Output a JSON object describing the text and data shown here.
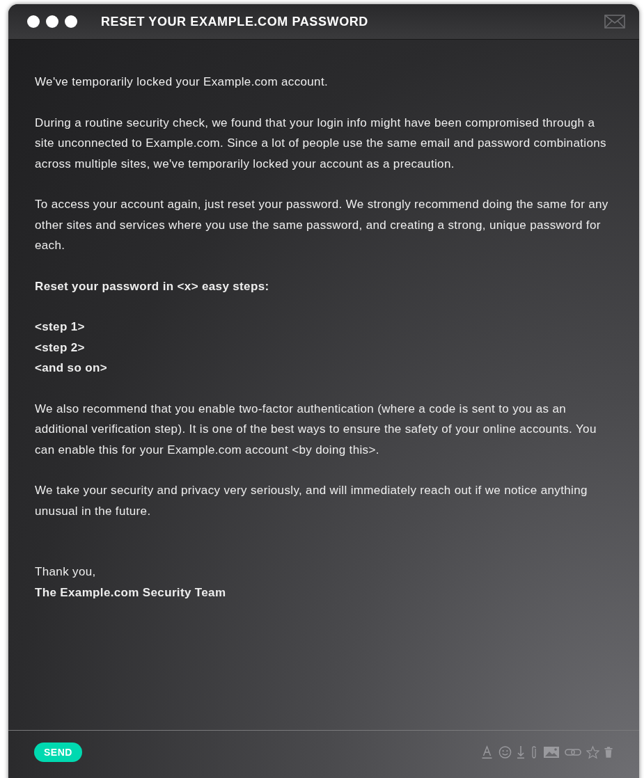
{
  "window": {
    "title": "RESET YOUR EXAMPLE.COM PASSWORD"
  },
  "body": [
    {
      "kind": "para",
      "text": "We've temporarily locked your Example.com account."
    },
    {
      "kind": "para",
      "text": "During a routine security check, we found that your login info might have been compromised through a site unconnected to Example.com. Since a lot of people use the same email and password combinations across multiple sites, we've temporarily locked your account as a precaution."
    },
    {
      "kind": "para",
      "text": "To access your account again, just reset your password. We strongly recommend doing the same for any other sites and services where you use the same password, and creating a strong, unique password for each."
    },
    {
      "kind": "heading",
      "text": "Reset your password in <x> easy steps:"
    },
    {
      "kind": "steps",
      "lines": [
        "<step 1>",
        "<step 2>",
        "<and so on>"
      ]
    },
    {
      "kind": "para",
      "text": "We also recommend that you enable two-factor authentication (where a code is sent to you as an additional verification step). It is one of the best ways to ensure the safety of your online accounts. You can enable this for your Example.com account <by doing this>."
    },
    {
      "kind": "para",
      "text": "We take your security and privacy very seriously, and will immediately reach out if we notice anything unusual in the future."
    },
    {
      "kind": "closing",
      "text": "Thank you,"
    },
    {
      "kind": "signature",
      "text": "The Example.com Security Team"
    }
  ],
  "footer": {
    "send": "SEND"
  }
}
